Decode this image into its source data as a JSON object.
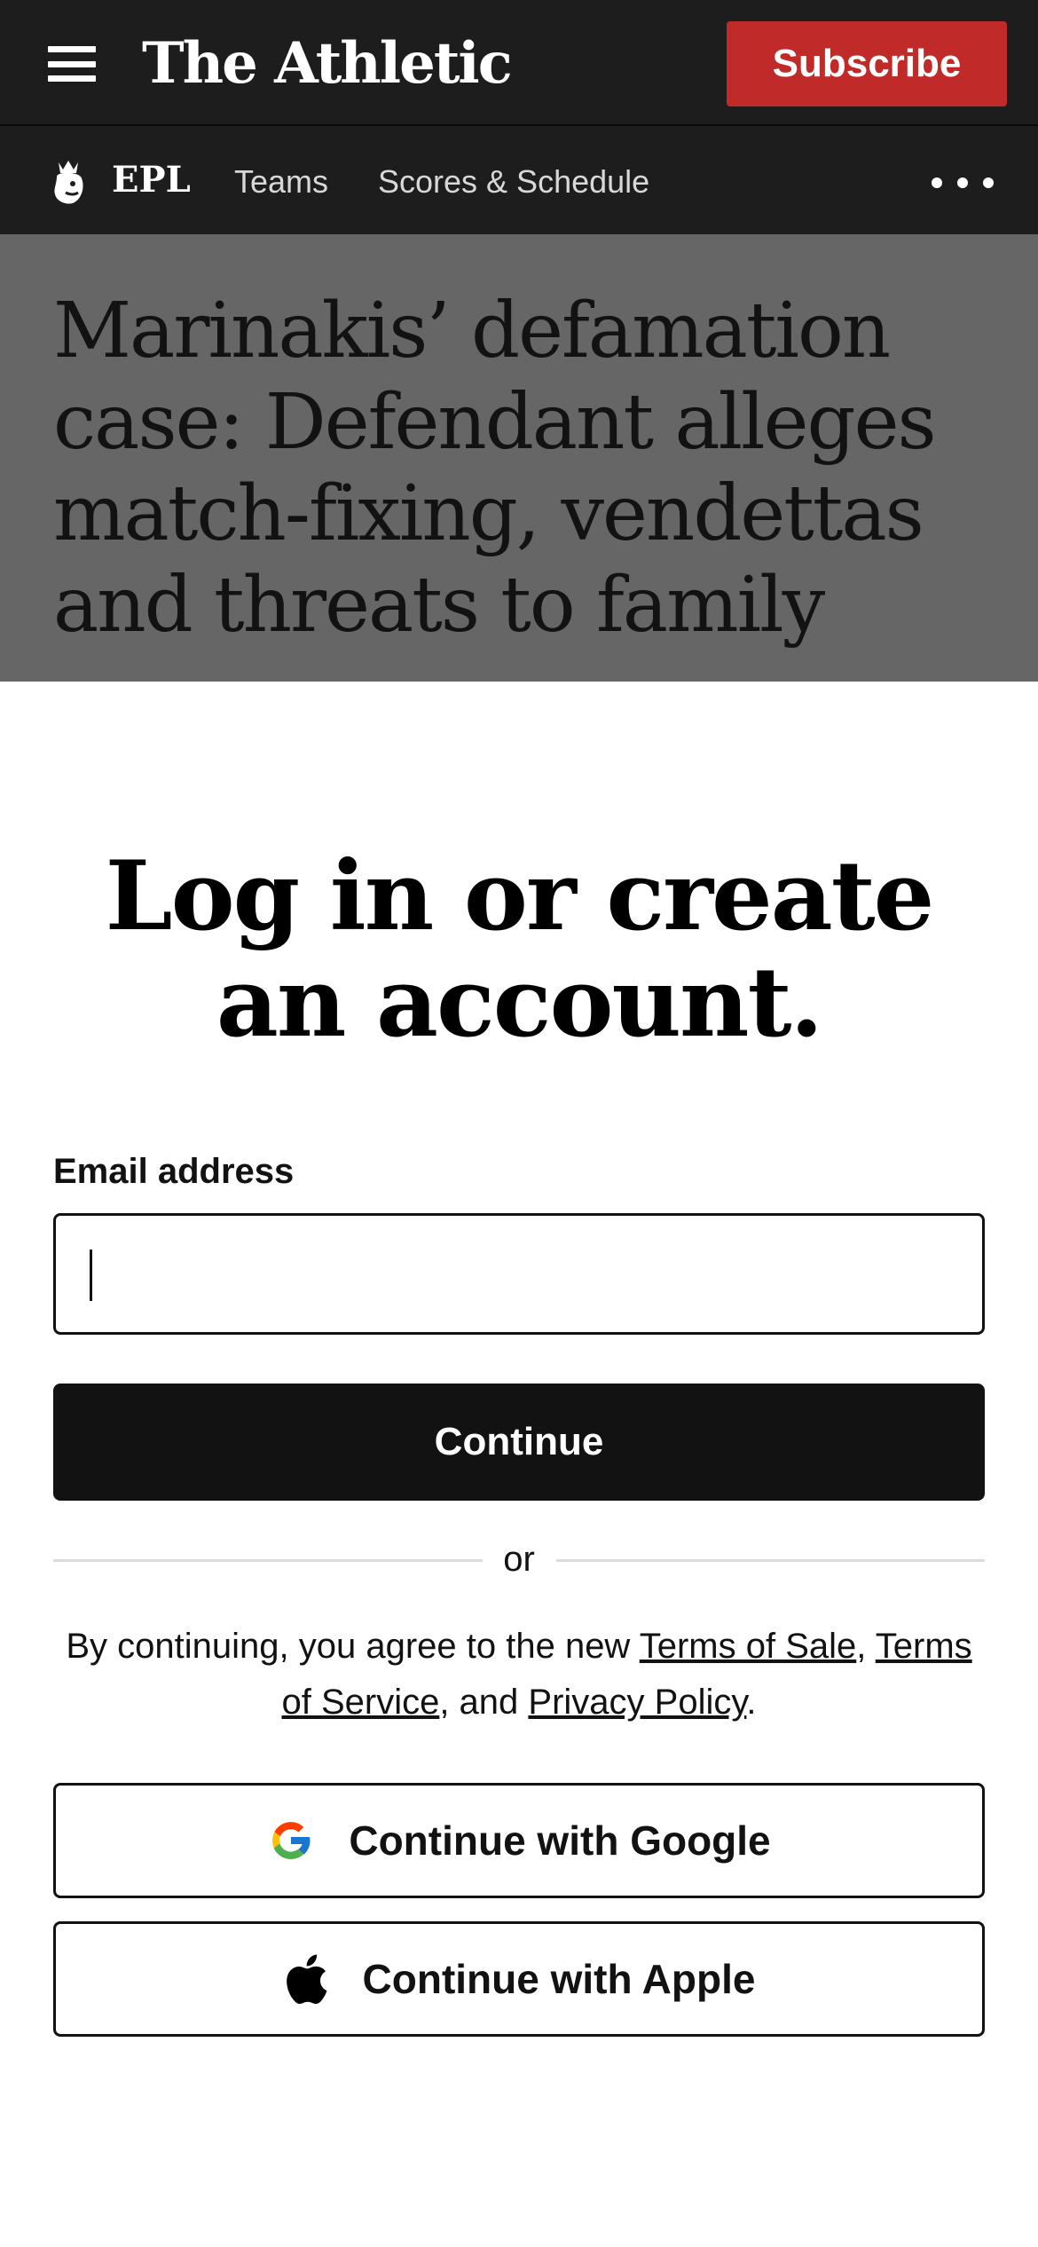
{
  "header": {
    "logo": "The Athletic",
    "subscribe_label": "Subscribe"
  },
  "subnav": {
    "league": "EPL",
    "links": [
      "Teams",
      "Scores & Schedule"
    ]
  },
  "article": {
    "headline": "Marinakis’ defamation case: Defendant alleges match-fixing, vendettas and threats to family"
  },
  "login": {
    "title": "Log in or create an account.",
    "email_label": "Email address",
    "email_value": "",
    "continue_label": "Continue",
    "or_text": "or",
    "legal": {
      "prefix": "By continuing, you agree to the new ",
      "terms_of_sale": "Terms of Sale",
      "sep1": ", ",
      "terms_of_service": "Terms of Service",
      "sep2": ", and ",
      "privacy_policy": "Privacy Policy",
      "suffix": "."
    },
    "google_label": "Continue with Google",
    "apple_label": "Continue with Apple"
  },
  "colors": {
    "header_bg": "#1d1d1d",
    "subscribe_bg": "#c02a29",
    "overlay_bg": "#666666",
    "button_bg": "#121212"
  },
  "icons": [
    "menu-icon",
    "premier-league-lion-icon",
    "more-dots-icon",
    "google-icon",
    "apple-icon"
  ]
}
